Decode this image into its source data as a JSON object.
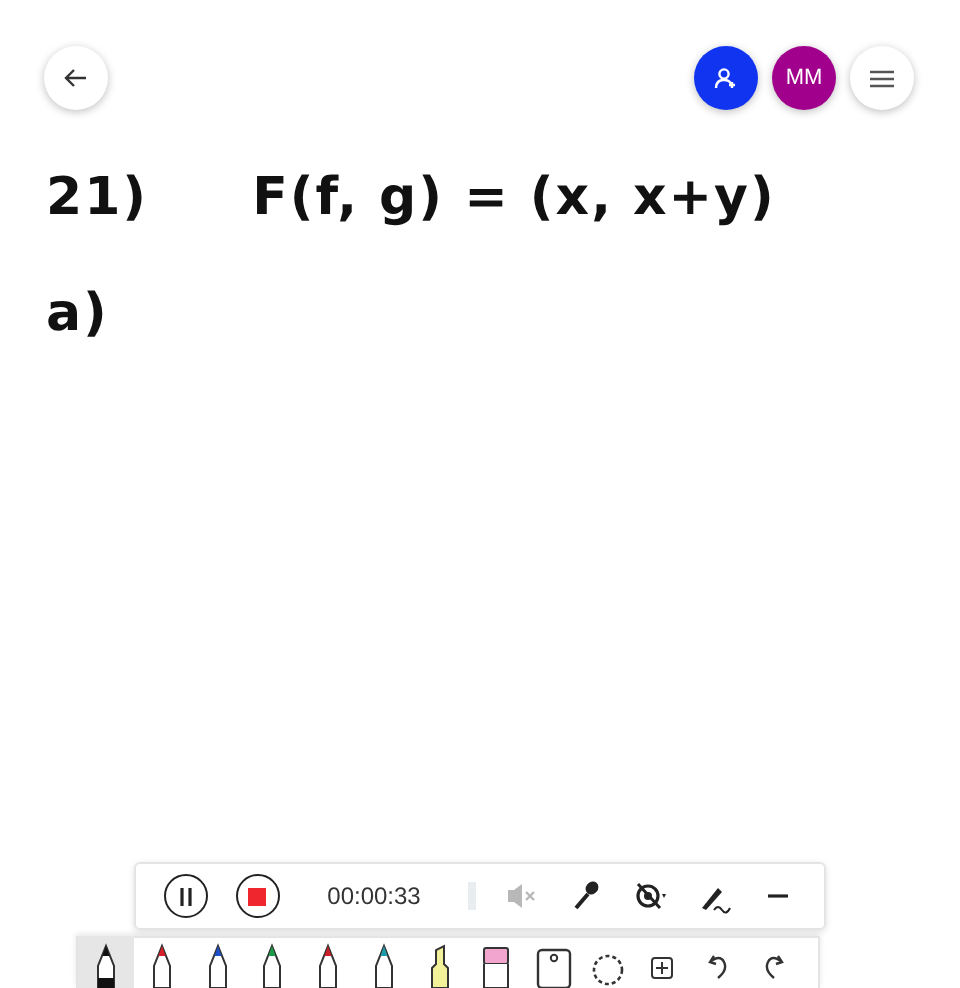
{
  "top_bar": {
    "back": {
      "kind": "back"
    },
    "actions": [
      {
        "kind": "invite",
        "color": "#1034f0"
      },
      {
        "kind": "avatar",
        "label": "MM",
        "color": "#a0008c"
      },
      {
        "kind": "menu"
      }
    ]
  },
  "ink": [
    [
      "21)",
      "F(f, g) = (x, x+y)"
    ],
    [
      "a)"
    ]
  ],
  "recorder": {
    "time": "00:00:33",
    "controls": [
      {
        "kind": "mute",
        "disabled": true
      },
      {
        "kind": "mic",
        "disabled": false
      },
      {
        "kind": "camera",
        "disabled": false
      },
      {
        "kind": "sign",
        "disabled": false
      },
      {
        "kind": "minimize",
        "disabled": false
      }
    ]
  },
  "tools": [
    {
      "kind": "pen",
      "color": "#111111",
      "selected": true
    },
    {
      "kind": "pen",
      "color": "#d8202a",
      "selected": false
    },
    {
      "kind": "pen",
      "color": "#1f4fc8",
      "selected": false
    },
    {
      "kind": "pen",
      "color": "#1d9a4a",
      "selected": false
    },
    {
      "kind": "pen",
      "color": "#c8202a",
      "selected": false
    },
    {
      "kind": "pen",
      "color": "#1f9aa8",
      "selected": false
    },
    {
      "kind": "highlighter",
      "color": "#f3f09a",
      "selected": false
    },
    {
      "kind": "eraser",
      "color": "#f2a6cf",
      "selected": false
    },
    {
      "kind": "image",
      "selected": false
    },
    {
      "kind": "lasso",
      "selected": false
    },
    {
      "kind": "add",
      "selected": false
    },
    {
      "kind": "undo",
      "selected": false
    },
    {
      "kind": "redo",
      "selected": false
    }
  ]
}
